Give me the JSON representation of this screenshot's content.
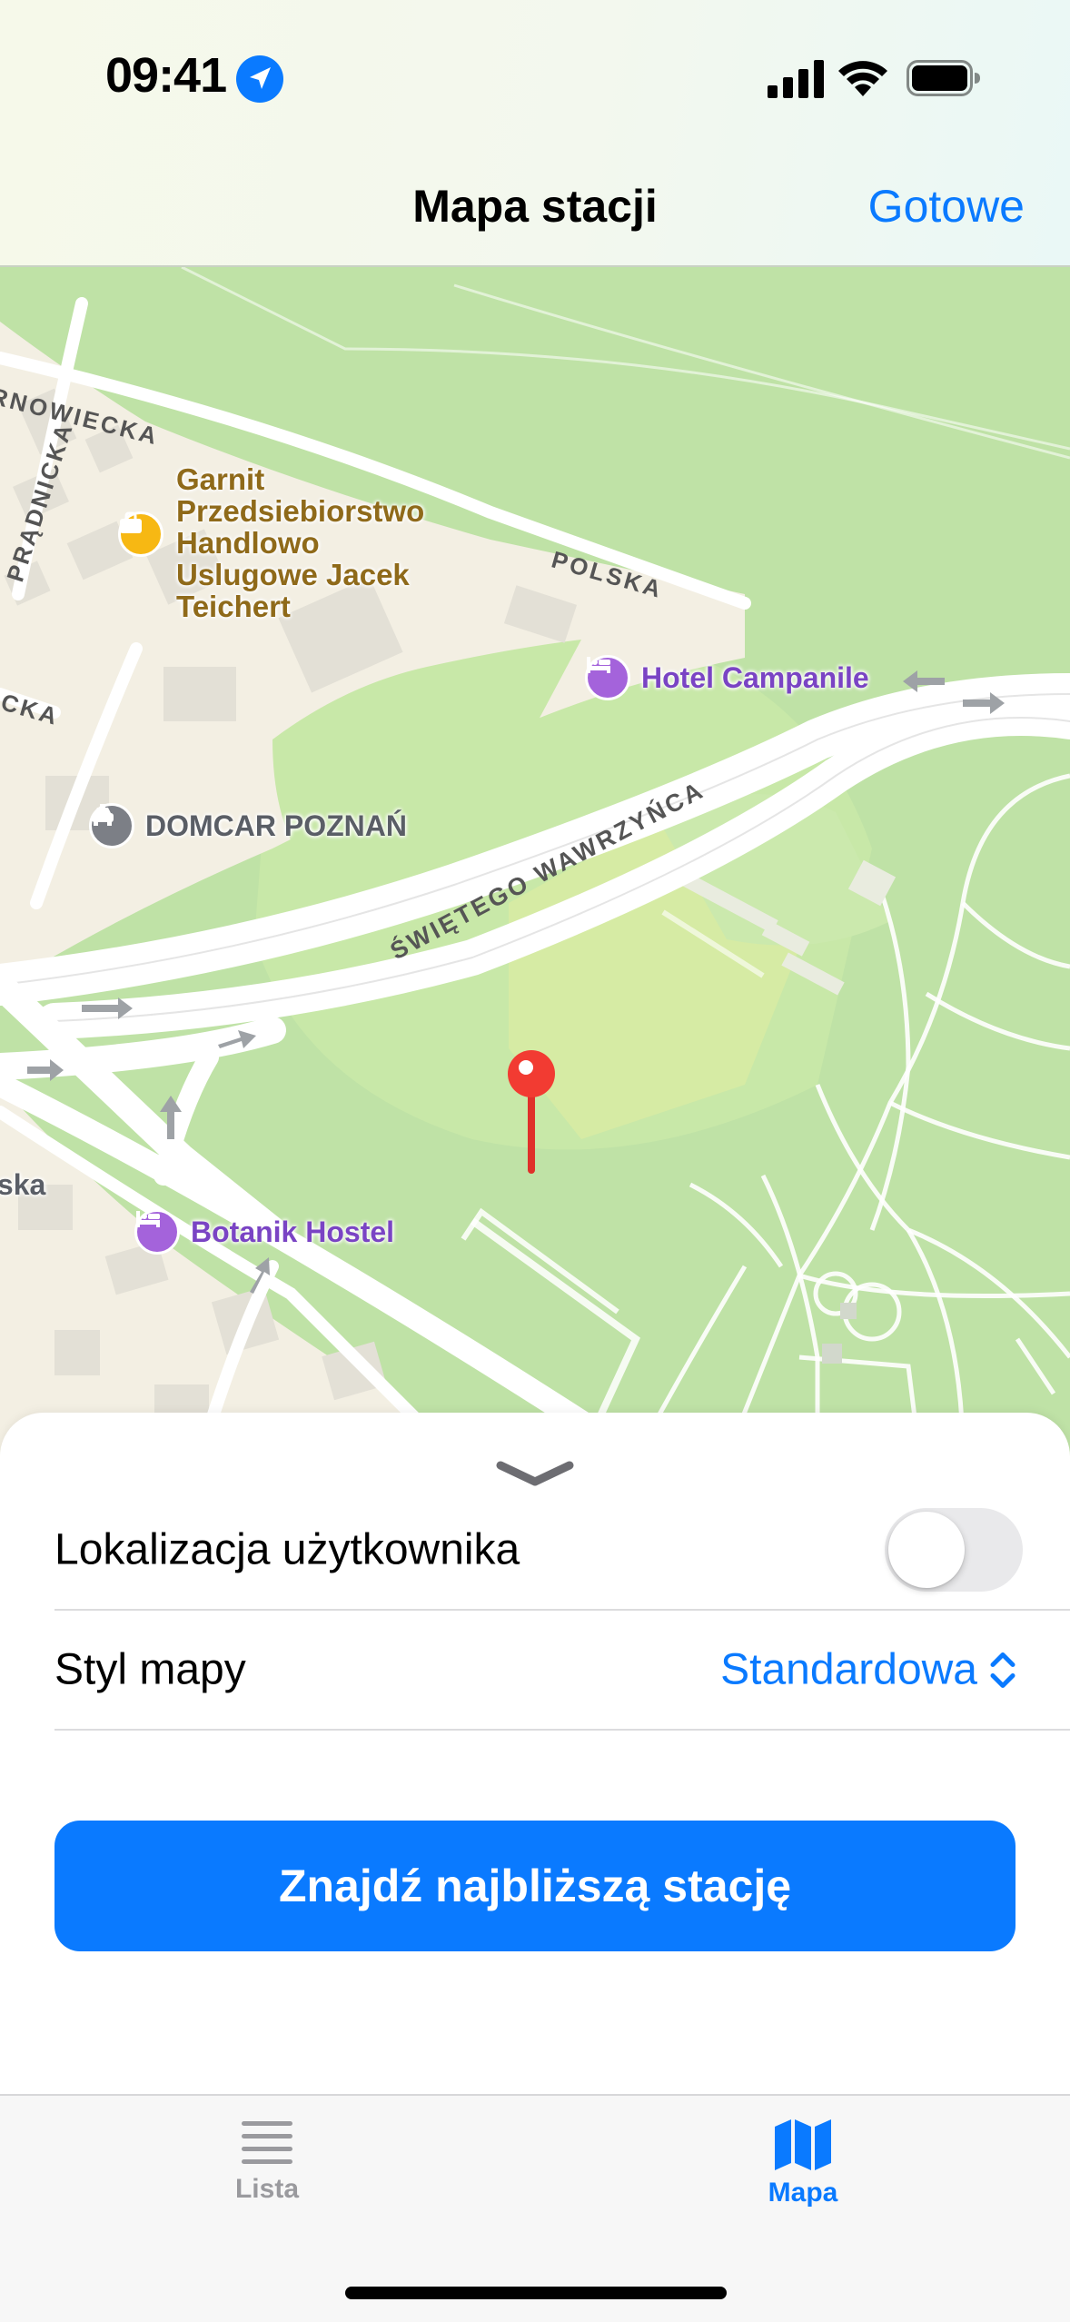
{
  "status_bar": {
    "time": "09:41",
    "icons": [
      "location-arrow-icon",
      "cellular-signal-icon",
      "wifi-icon",
      "battery-icon"
    ]
  },
  "nav": {
    "title": "Mapa stacji",
    "done_label": "Gotowe"
  },
  "map": {
    "streets": [
      "RNOWIECKA",
      "PRĄDNICKA",
      "POLSKA",
      "ICKA",
      "ŚWIĘTEGO WAWRZYŃCA"
    ],
    "places": {
      "shop": "Garnit Przedsiebiorstwo Handlowo Uslugowe Jacek Teichert",
      "shop_lines": [
        "Garnit",
        "Przedsiebiorstwo",
        "Handlowo",
        "Uslugowe Jacek",
        "Teichert"
      ],
      "hotel_campanile": "Hotel Campanile",
      "domcar": "DOMCAR POZNAŃ",
      "botanik": "Botanik Hostel",
      "partial_label": "lska"
    },
    "pin_icon": "map-pin-icon"
  },
  "sheet": {
    "location_label": "Lokalizacja użytkownika",
    "location_toggle_on": false,
    "style_label": "Styl mapy",
    "style_value": "Standardowa",
    "find_button": "Znajdź najbliższą stację"
  },
  "tabbar": {
    "tabs": [
      {
        "label": "Lista",
        "icon": "list-icon",
        "selected": false
      },
      {
        "label": "Mapa",
        "icon": "map-icon",
        "selected": true
      }
    ]
  },
  "colors": {
    "accent": "#0a7aff",
    "hotel": "#a463db",
    "pin": "#f23b32",
    "map_park": "#bfe2a6",
    "map_urban": "#f3efe3"
  }
}
